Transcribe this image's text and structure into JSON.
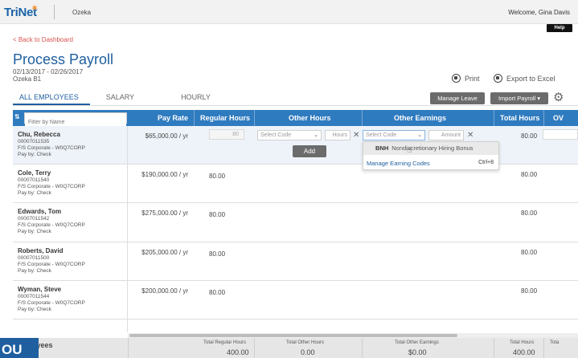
{
  "topbar": {
    "logo": "TriNet",
    "company": "Ozeka",
    "welcome": "Welcome, Gina Davis"
  },
  "help_label": "Help",
  "back_link": "< Back to Dashboard",
  "page": {
    "title": "Process Payroll",
    "date_range": "02/13/2017 - 02/26/2017",
    "entity": "Ozeka B1"
  },
  "actions": {
    "print": "Print",
    "export": "Export to Excel",
    "manage_leave": "Manage Leave",
    "import_payroll": "Import Payroll"
  },
  "tabs": [
    {
      "label": "ALL EMPLOYEES",
      "active": true
    },
    {
      "label": "SALARY",
      "active": false
    },
    {
      "label": "HOURLY",
      "active": false
    }
  ],
  "grid": {
    "filter_placeholder": "Filter by Name",
    "headers": {
      "pay_rate": "Pay Rate",
      "regular_hours": "Regular Hours",
      "other_hours": "Other Hours",
      "other_earnings": "Other Earnings",
      "total_hours": "Total Hours",
      "ov": "OV"
    },
    "editor": {
      "select_code": "Select Code",
      "hours_placeholder": "Hours",
      "amount_placeholder": "Amount",
      "add_label": "Add"
    },
    "rows": [
      {
        "name": "Chu, Rebecca",
        "id": "00007011535",
        "dept": "F/S Corporate - W0Q7CORP",
        "pay_by": "Pay by: Check",
        "pay_rate": "$65,000.00 / yr",
        "regular_hours": "80",
        "total_hours": "80.00"
      },
      {
        "name": "Cole, Terry",
        "id": "00007011540",
        "dept": "F/S Corporate - W0Q7CORP",
        "pay_by": "Pay by: Check",
        "pay_rate": "$190,000.00 / yr",
        "regular_hours": "80.00",
        "total_hours": "80.00"
      },
      {
        "name": "Edwards, Tom",
        "id": "00007011542",
        "dept": "F/S Corporate - W0Q7CORP",
        "pay_by": "Pay by: Check",
        "pay_rate": "$275,000.00 / yr",
        "regular_hours": "80.00",
        "total_hours": "80.00"
      },
      {
        "name": "Roberts, David",
        "id": "00007011500",
        "dept": "F/S Corporate - W0Q7CORP",
        "pay_by": "Pay by: Check",
        "pay_rate": "$205,000.00 / yr",
        "regular_hours": "80.00",
        "total_hours": "80.00"
      },
      {
        "name": "Wyman, Steve",
        "id": "00007011544",
        "dept": "F/S Corporate - W0Q7CORP",
        "pay_by": "Pay by: Check",
        "pay_rate": "$200,000.00 / yr",
        "regular_hours": "80.00",
        "total_hours": "80.00"
      }
    ]
  },
  "dropdown": {
    "code": "BNH",
    "label": "Nondiscretionary Hiring Bonus",
    "manage": "Manage Earning Codes",
    "shortcut": "Ctrl+8"
  },
  "footer": {
    "title": "ployees",
    "corner": "OU",
    "total_regular_hours_label": "Total Regular Hours",
    "total_regular_hours": "400.00",
    "total_other_hours_label": "Total Other Hours",
    "total_other_hours": "0.00",
    "total_other_earnings_label": "Total Other Earnings",
    "total_other_earnings": "$0.00",
    "total_hours_label": "Total Hours",
    "total_hours": "400.00",
    "total_label_cut": "Tota"
  }
}
